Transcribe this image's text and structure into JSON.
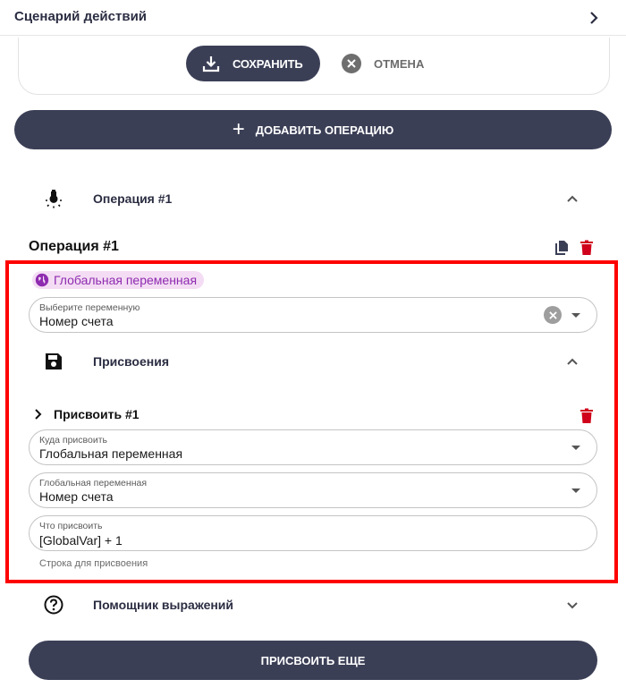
{
  "header": {
    "title": "Сценарий действий"
  },
  "toolbar": {
    "save_label": "СОХРАНИТЬ",
    "cancel_label": "ОТМЕНА"
  },
  "add_operation": {
    "label": "ДОБАВИТЬ ОПЕРАЦИЮ"
  },
  "operation_accordion": {
    "label": "Операция #1"
  },
  "operation": {
    "title": "Операция #1",
    "scope_chip": "Глобальная переменная",
    "variable_select": {
      "label": "Выберите переменную",
      "value": "Номер счета"
    }
  },
  "assignments_accordion": {
    "label": "Присвоения"
  },
  "assignment": {
    "title": "Присвоить #1",
    "target_field": {
      "label": "Куда присвоить",
      "value": "Глобальная переменная"
    },
    "global_var_field": {
      "label": "Глобальная переменная",
      "value": "Номер счета"
    },
    "value_field": {
      "label": "Что присвоить",
      "value": "[GlobalVar] + 1"
    },
    "helper_text": "Строка для присвоения"
  },
  "expression_helper": {
    "label": "Помощник выражений"
  },
  "assign_more": {
    "label": "ПРИСВОИТЬ ЕЩЕ"
  },
  "colors": {
    "primary": "#3b3f56",
    "highlight": "#ff0000",
    "chip_bg": "#f4ddf4",
    "chip_text": "#8e2bb0",
    "delete": "#d0021b"
  }
}
